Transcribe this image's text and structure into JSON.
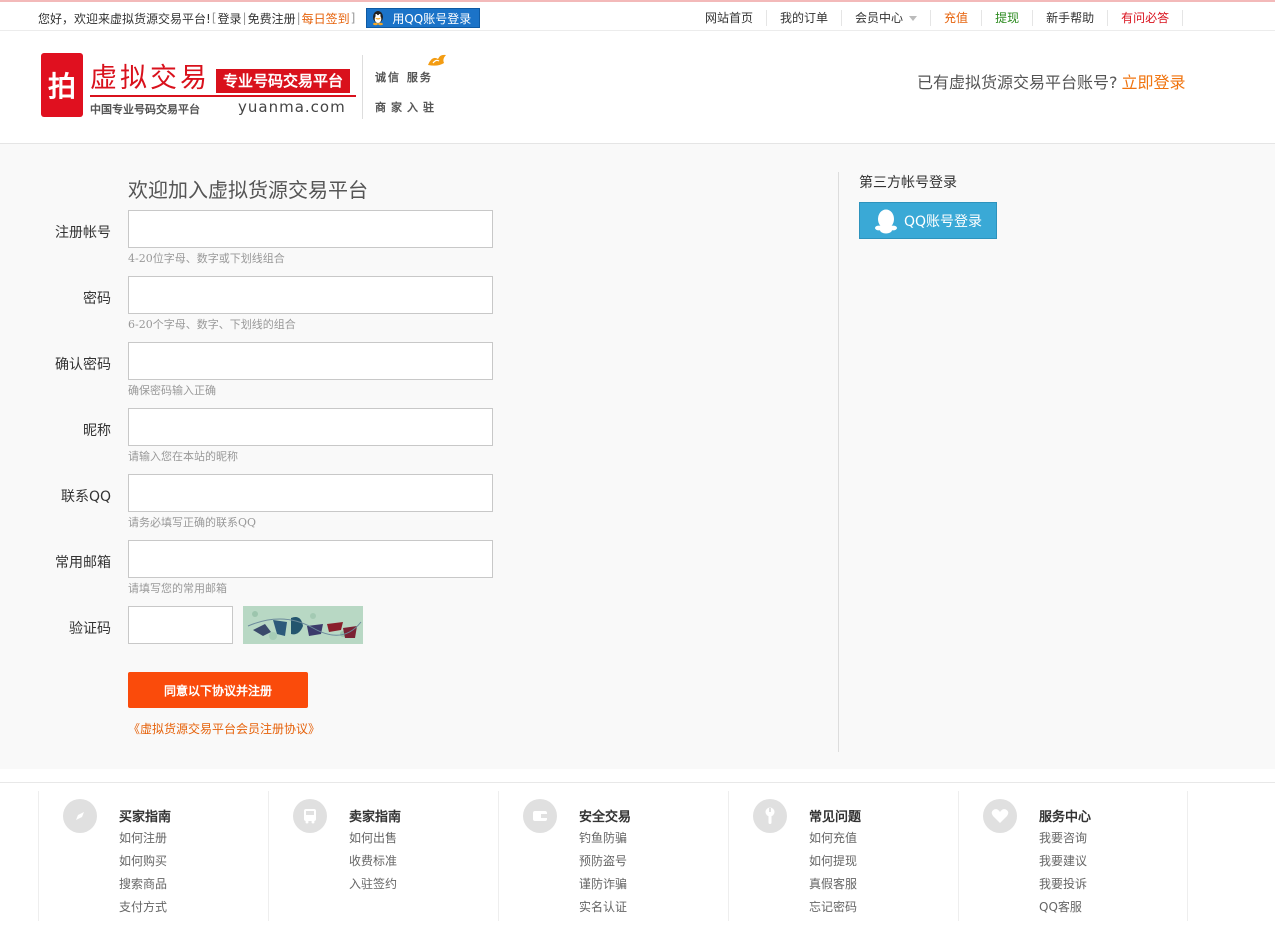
{
  "topbar": {
    "greeting": "您好，欢迎来虚拟货源交易平台!",
    "login": "登录",
    "register": "免费注册",
    "checkin": "每日签到",
    "qq_login": "用QQ账号登录",
    "nav": [
      {
        "label": "网站首页",
        "color": "#333333"
      },
      {
        "label": "我的订单",
        "color": "#333333"
      },
      {
        "label": "会员中心",
        "color": "#333333"
      },
      {
        "label": "充值",
        "color": "#e6620b"
      },
      {
        "label": "提现",
        "color": "#2b8a1e"
      },
      {
        "label": "新手帮助",
        "color": "#333333"
      },
      {
        "label": "有问必答",
        "color": "#d9111c"
      }
    ]
  },
  "header": {
    "logo_badge": "拍",
    "logo_main": "虚拟交易",
    "logo_tag": "专业号码交易平台",
    "logo_sub": "中国专业号码交易平台",
    "logo_domain": "yuanma.com",
    "logo_service1": "诚信 服务",
    "logo_service2": "商家入驻",
    "account_prompt": "已有虚拟货源交易平台账号?",
    "login_link": "立即登录"
  },
  "form": {
    "title": "欢迎加入虚拟货源交易平台",
    "fields": [
      {
        "label": "注册帐号",
        "value": "",
        "hint": "4-20位字母、数字或下划线组合"
      },
      {
        "label": "密码",
        "value": "",
        "hint": "6-20个字母、数字、下划线的组合"
      },
      {
        "label": "确认密码",
        "value": "",
        "hint": "确保密码输入正确"
      },
      {
        "label": "昵称",
        "value": "",
        "hint": "请输入您在本站的昵称"
      },
      {
        "label": "联系QQ",
        "value": "",
        "hint": "请务必填写正确的联系QQ"
      },
      {
        "label": "常用邮箱",
        "value": "",
        "hint": "请填写您的常用邮箱"
      }
    ],
    "captcha_label": "验证码",
    "captcha_value": "",
    "submit": "同意以下协议并注册",
    "agreement": "《虚拟货源交易平台会员注册协议》"
  },
  "third_party": {
    "title": "第三方帐号登录",
    "qq_button": "QQ账号登录"
  },
  "footer": {
    "columns": [
      {
        "title": "买家指南",
        "icon": "compass-icon",
        "links": [
          "如何注册",
          "如何购买",
          "搜索商品",
          "支付方式"
        ]
      },
      {
        "title": "卖家指南",
        "icon": "bus-icon",
        "links": [
          "如何出售",
          "收费标准",
          "入驻签约"
        ]
      },
      {
        "title": "安全交易",
        "icon": "wallet-icon",
        "links": [
          "钓鱼防骗",
          "预防盗号",
          "谨防诈骗",
          "实名认证"
        ]
      },
      {
        "title": "常见问题",
        "icon": "wrench-icon",
        "links": [
          "如何充值",
          "如何提现",
          "真假客服",
          "忘记密码"
        ]
      },
      {
        "title": "服务中心",
        "icon": "heart-icon",
        "links": [
          "我要咨询",
          "我要建议",
          "我要投诉",
          "QQ客服"
        ]
      }
    ]
  }
}
